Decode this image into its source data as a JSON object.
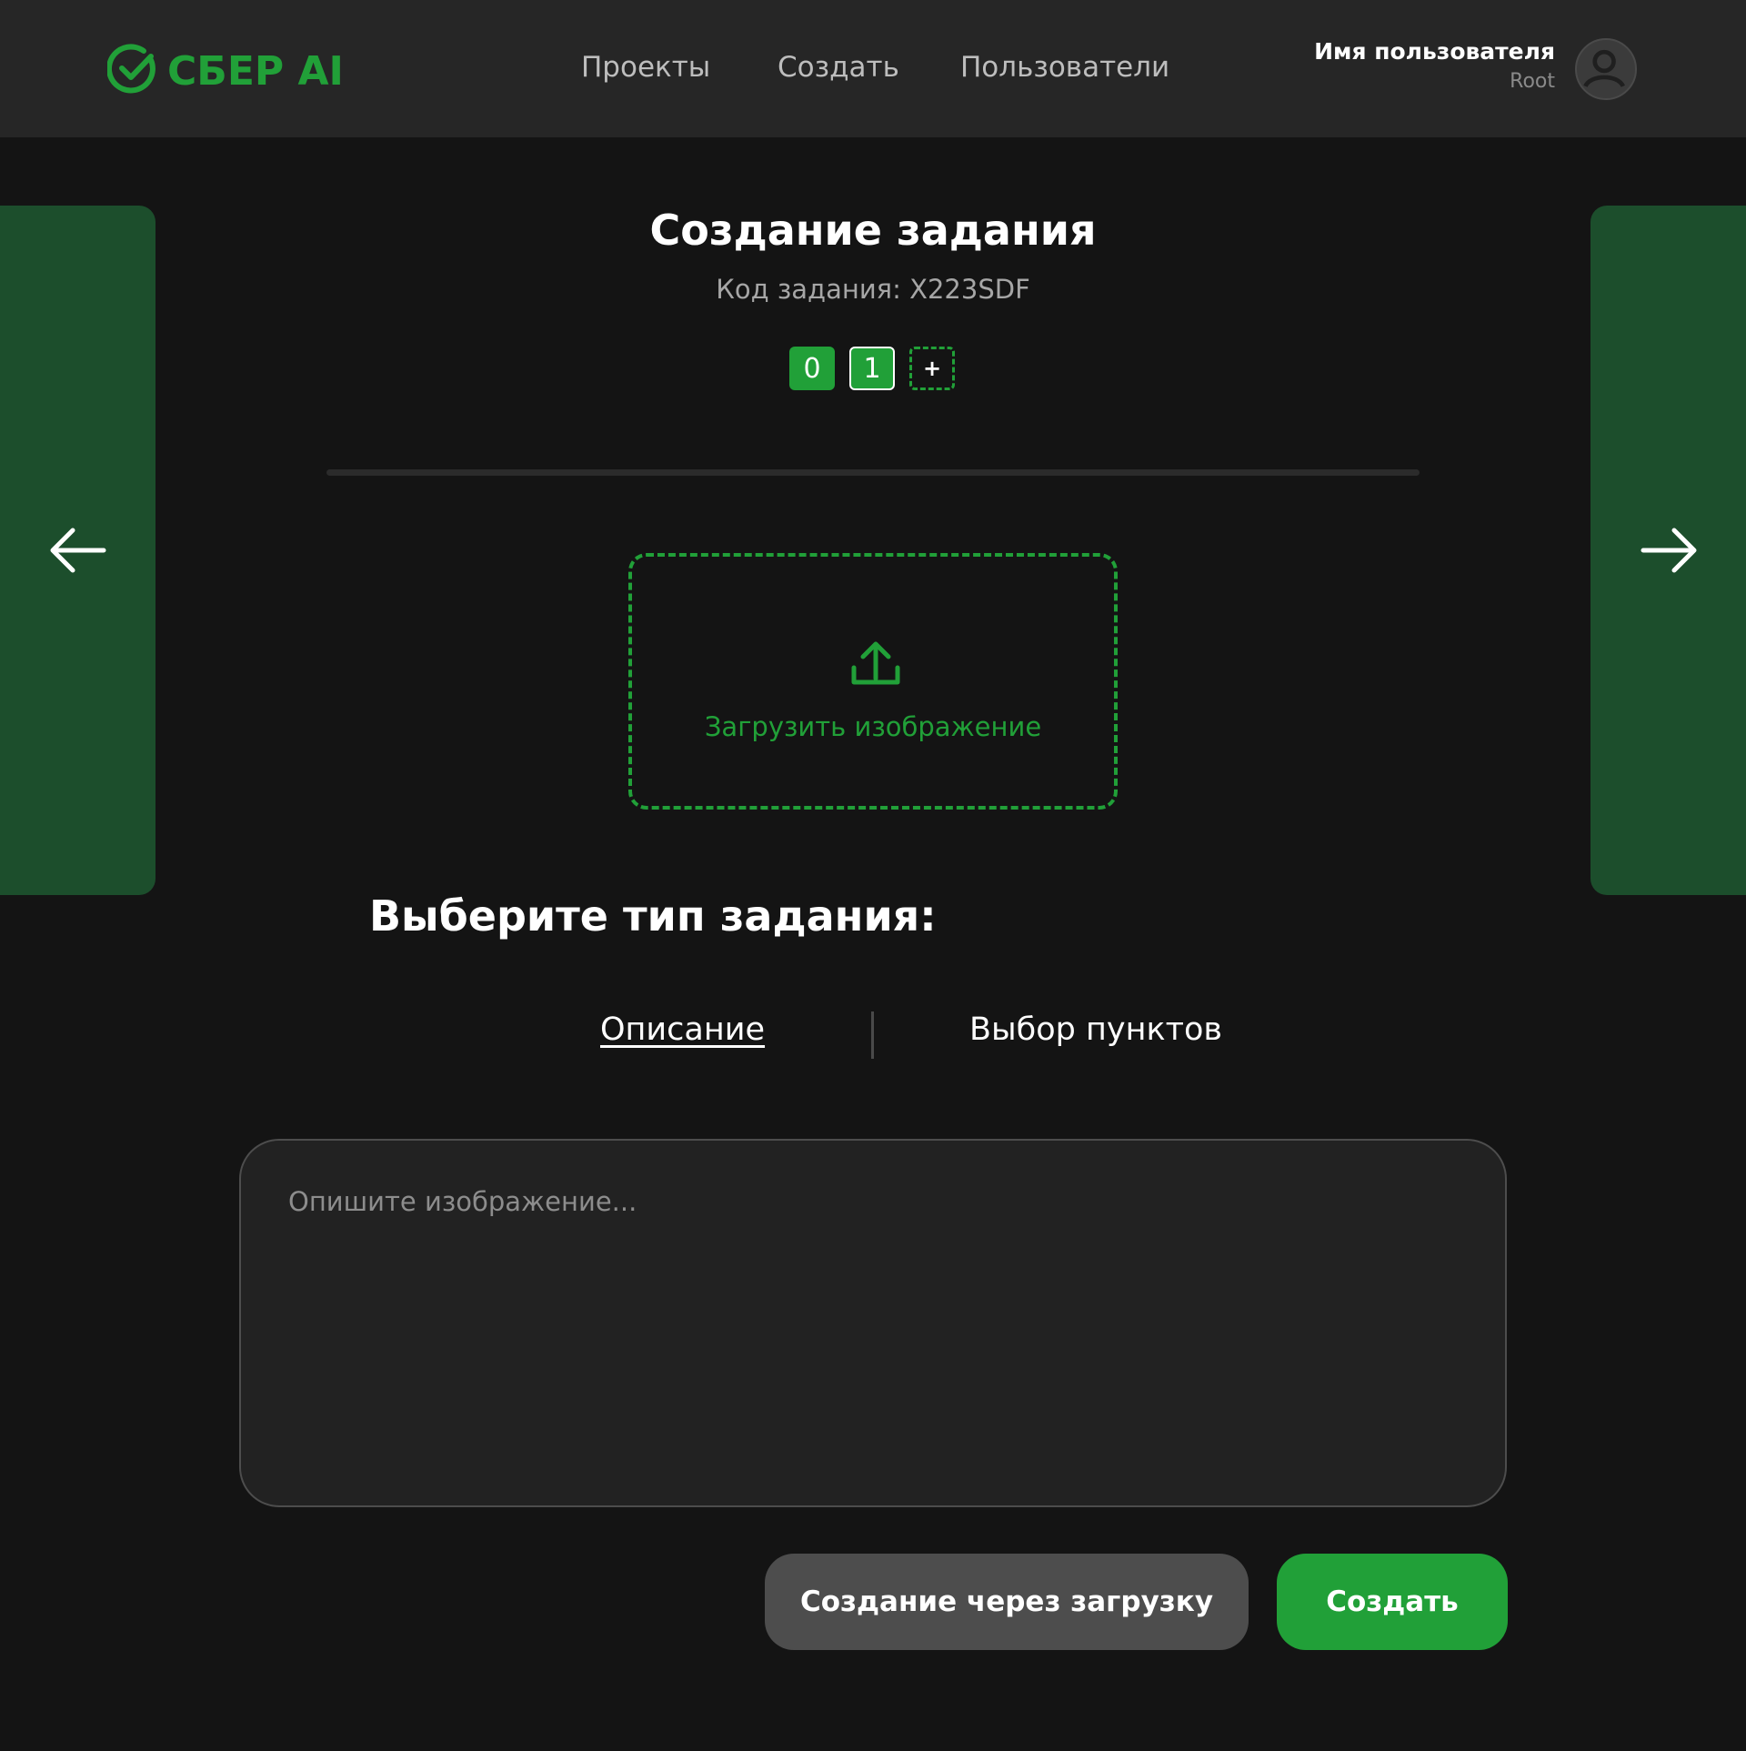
{
  "header": {
    "logo_text": "СБЕР AI",
    "nav": [
      "Проекты",
      "Создать",
      "Пользователи"
    ],
    "user_name": "Имя пользователя",
    "user_role": "Root"
  },
  "page": {
    "title": "Создание задания",
    "code_label": "Код задания: X223SDF",
    "steps": [
      "0",
      "1"
    ],
    "add_step": "+",
    "upload_label": "Загрузить изображение",
    "section_title": "Выберите тип задания:",
    "tabs": [
      "Описание",
      "Выбор пунктов"
    ],
    "active_tab": "Описание",
    "textarea_placeholder": "Опишите изображение...",
    "btn_upload": "Создание через загрузку",
    "btn_create": "Создать"
  },
  "colors": {
    "accent": "#21a038",
    "side_panel": "#1c4e2c",
    "background": "#141414",
    "header": "#262626"
  },
  "icons": [
    "sber-logo-icon",
    "avatar-icon",
    "arrow-left-icon",
    "arrow-right-icon",
    "upload-icon"
  ]
}
